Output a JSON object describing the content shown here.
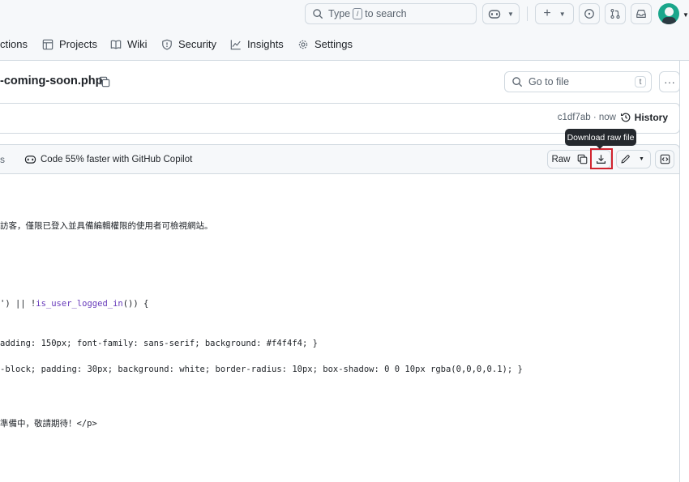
{
  "topbar": {
    "search_prefix": "Type",
    "search_key": "/",
    "search_suffix": "to search",
    "add_label": "+"
  },
  "repo_nav": {
    "items": [
      {
        "label": "ctions",
        "icon": "actions-icon"
      },
      {
        "label": "Projects",
        "icon": "table-icon"
      },
      {
        "label": "Wiki",
        "icon": "book-icon"
      },
      {
        "label": "Security",
        "icon": "shield-icon"
      },
      {
        "label": "Insights",
        "icon": "graph-icon"
      },
      {
        "label": "Settings",
        "icon": "gear-icon"
      }
    ]
  },
  "file": {
    "name": "-coming-soon.php",
    "goto_placeholder": "Go to file",
    "goto_key": "t",
    "more": "···"
  },
  "commit": {
    "hash": "c1df7ab",
    "sep": "·",
    "time": "now",
    "history_label": "History"
  },
  "tooltip": {
    "text": "Download raw file"
  },
  "file_header": {
    "left_fragment": "s",
    "copilot_text": "Code 55% faster with GitHub Copilot",
    "raw_label": "Raw"
  },
  "code": {
    "line_comment": "訪客，僅限已登入並具備編輯權限的使用者可檢視網站。",
    "line_cond_prefix": "') || !",
    "line_cond_fn": "is_user_logged_in",
    "line_cond_suffix": "()) {",
    "line_css1": "adding: 150px; font-family: sans-serif; background: #f4f4f4; }",
    "line_css2": "-block; padding: 30px; background: white; border-radius: 10px; box-shadow: 0 0 10px rgba(0,0,0,0.1); }",
    "line_p_cjk": "準備中，敬請期待！",
    "line_p_tag": "</p>"
  },
  "colors": {
    "highlight": "#d1242f",
    "function": "#6639ba",
    "tooltip_bg": "#25292e"
  }
}
